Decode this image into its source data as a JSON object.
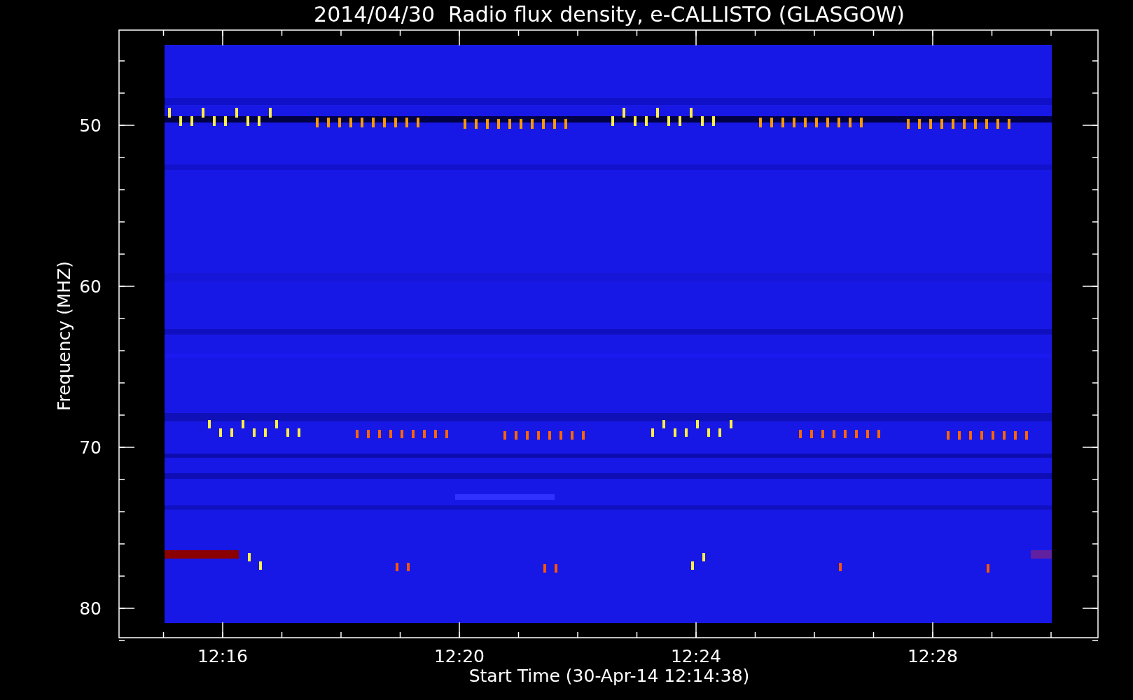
{
  "title": "2014/04/30  Radio flux density, e-CALLISTO (GLASGOW)",
  "y_axis": {
    "label": "Frequency (MHZ)",
    "ticks": [
      "50",
      "60",
      "70",
      "80"
    ]
  },
  "x_axis": {
    "label": "Start Time (30-Apr-14 12:14:38)",
    "ticks": [
      "12:16",
      "12:20",
      "12:24",
      "12:28"
    ]
  }
}
